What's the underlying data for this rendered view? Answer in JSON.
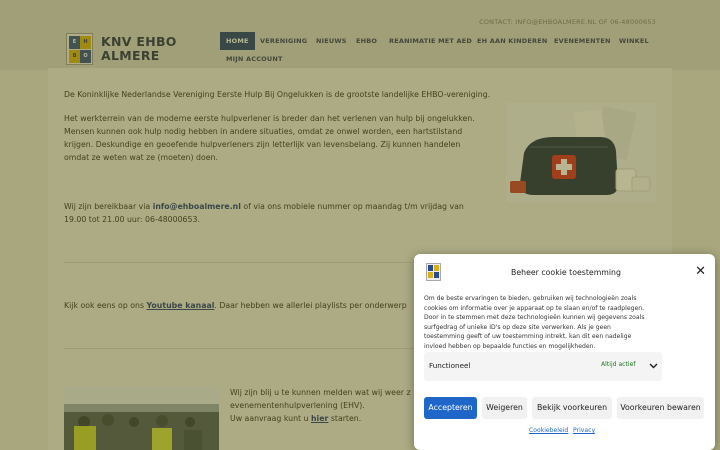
{
  "header": {
    "contact": "CONTACT: INFO@EHBOALMERE.NL OF 06-48000653",
    "logo_title_line1": "KNV EHBO",
    "logo_title_line2": "ALMERE",
    "logo_letters": [
      "E",
      "H",
      "B",
      "O"
    ]
  },
  "nav": {
    "items": [
      "HOME",
      "VERENIGING",
      "NIEUWS",
      "EHBO",
      "REANIMATIE MET AED",
      "EH AAN KINDEREN",
      "EVENEMENTEN",
      "WINKEL",
      "MIJN ACCOUNT"
    ],
    "active": "HOME"
  },
  "main": {
    "intro": "De Koninklijke Nederlandse Vereniging Eerste Hulp Bij Ongelukken is de grootste landelijke EHBO-vereniging.",
    "para2_l1": "Het werkterrein van de moderne eerste hulpverlener is breder dan het verlenen van hulp bij ongelukken.",
    "para2_l2": "Mensen kunnen ook hulp nodig hebben in andere situaties, omdat ze onwel worden, een hartstilstand",
    "para2_l3": "krijgen. Deskundige en geoefende hulpverleners zijn letterlijk van levensbelang. Zij kunnen handelen",
    "para2_l4": "omdat ze weten wat ze (moeten) doen.",
    "contact_pre": "Wij zijn bereikbaar via ",
    "contact_email": "info@ehboalmere.nl",
    "contact_post": " of via ons mobiele nummer op maandag t/m vrijdag van",
    "contact_l2": "19.00 tot 21.00 uur: 06-48000653.",
    "youtube_pre": "Kijk ook eens op ons ",
    "youtube_link": "Youtube kanaal",
    "youtube_post": ". Daar hebben we allerlei playlists per onderwerp",
    "events_l1": "Wij zijn blij u te kunnen melden wat wij weer z",
    "events_l2": "evenementenhulpverlening (EHV).",
    "events_l3_pre": "Uw aanvraag kunt u ",
    "events_link": "hier",
    "events_l3_post": " starten."
  },
  "cookie": {
    "title": "Beheer cookie toestemming",
    "text": "Om de beste ervaringen te bieden, gebruiken wij technologieën zoals cookies om informatie over je apparaat op te slaan en/of te raadplegen. Door in te stemmen met deze technologieën kunnen wij gegevens zoals surfgedrag of unieke ID's op deze site verwerken. Als je geen toestemming geeft of uw toestemming intrekt, kan dit een nadelige invloed hebben op bepaalde functies en mogelijkheden.",
    "functional_label": "Functioneel",
    "functional_status": "Altijd actief",
    "buttons": {
      "accept": "Accepteren",
      "deny": "Weigeren",
      "view": "Bekijk voorkeuren",
      "save": "Voorkeuren bewaren"
    },
    "links": {
      "policy": "Cookiebeleid",
      "privacy": "Privacy"
    }
  },
  "colors": {
    "nav_active": "#1c3579",
    "overlay": "#605e0a",
    "primary_button": "#1e67c8",
    "status_green": "#1a7a1a"
  }
}
